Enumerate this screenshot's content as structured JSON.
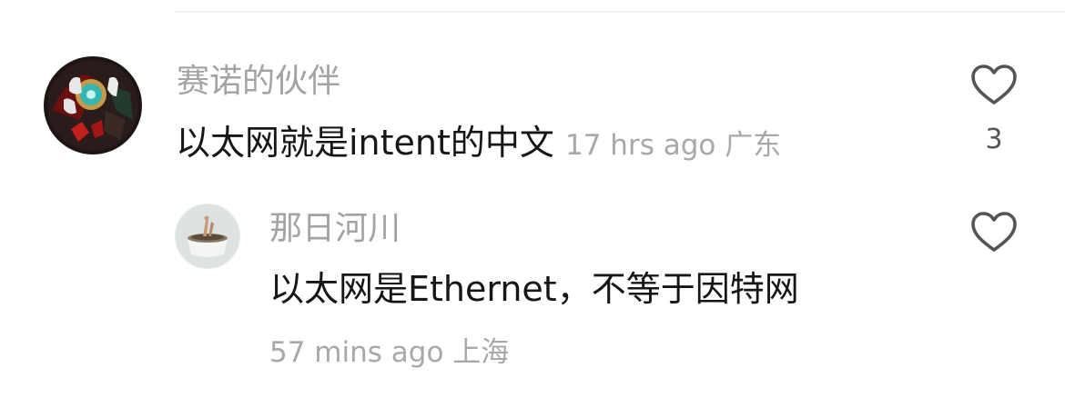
{
  "comments": [
    {
      "username": "赛诺的伙伴",
      "text": "以太网就是intent的中文",
      "time": "17 hrs ago",
      "location": "广东",
      "likes": "3",
      "avatar_icon": "user-avatar-icon"
    }
  ],
  "reply": {
    "username": "那日河川",
    "text": "以太网是Ethernet，不等于因特网",
    "time": "57 mins ago",
    "location": "上海",
    "avatar_icon": "user-avatar-icon"
  },
  "icons": {
    "like": "heart-icon"
  },
  "colors": {
    "username": "#a3a3a3",
    "text": "#161616",
    "meta": "#a8a8a8",
    "icon": "#555555"
  }
}
